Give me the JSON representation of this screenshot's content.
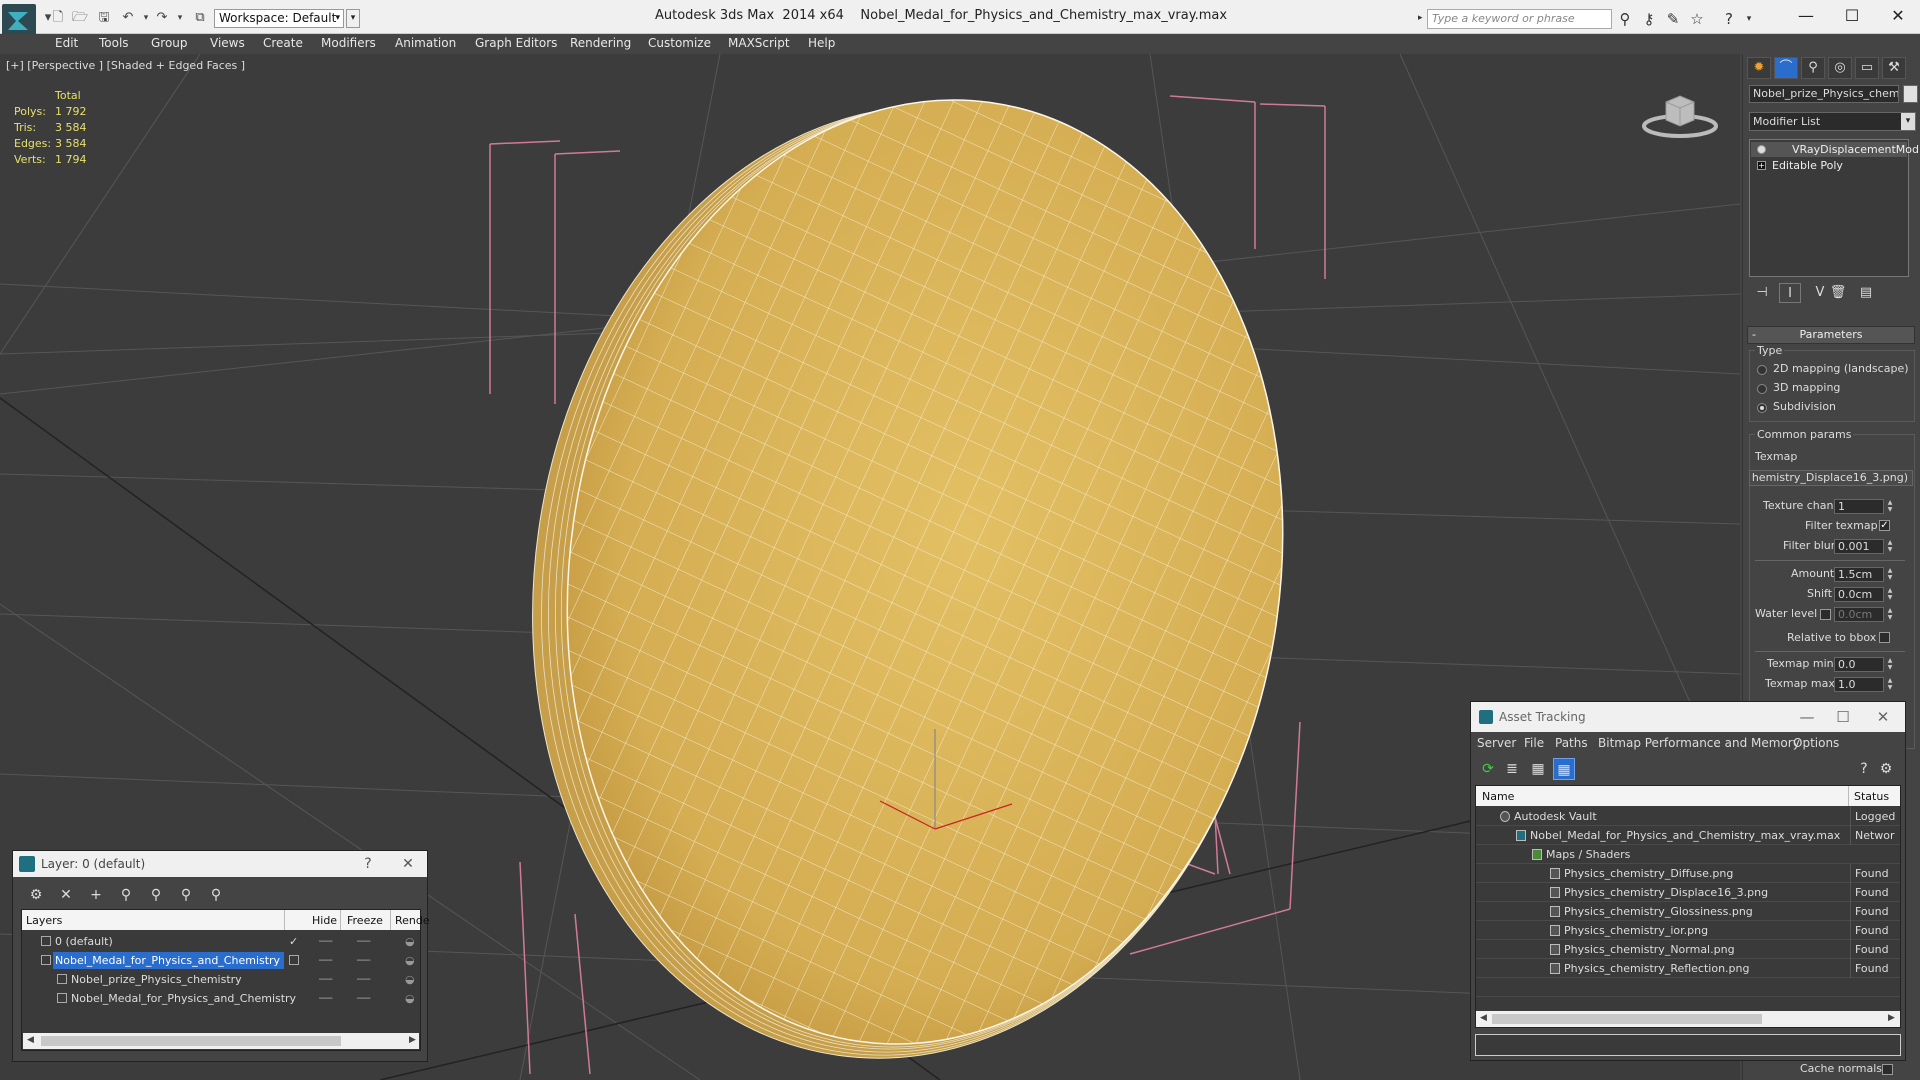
{
  "titlebar": {
    "workspace": "Workspace: Default",
    "app_name": "Autodesk 3ds Max  2014 x64",
    "file_name": "Nobel_Medal_for_Physics_and_Chemistry_max_vray.max",
    "search_placeholder": "Type a keyword or phrase"
  },
  "menu": [
    "Edit",
    "Tools",
    "Group",
    "Views",
    "Create",
    "Modifiers",
    "Animation",
    "Graph Editors",
    "Rendering",
    "Customize",
    "MAXScript",
    "Help"
  ],
  "viewport": {
    "label": "[+] [Perspective ] [Shaded + Edged Faces ]",
    "stats": {
      "header": "Total",
      "rows": [
        {
          "label": "Polys:",
          "value": "1 792"
        },
        {
          "label": "Tris:",
          "value": "3 584"
        },
        {
          "label": "Edges:",
          "value": "3 584"
        },
        {
          "label": "Verts:",
          "value": "1 794"
        }
      ]
    },
    "colors": {
      "background": "#3c3c3c",
      "grid": "#555555",
      "medal": "#d9b35a",
      "wire": "#f4eed8",
      "bbox": "#d07a9a"
    }
  },
  "command_panel": {
    "object_name": "Nobel_prize_Physics_chemistry",
    "modifier_list": "Modifier List",
    "stack": [
      "VRayDisplacementMod",
      "Editable Poly"
    ],
    "parameters_title": "Parameters",
    "type_label": "Type",
    "type_options": [
      "2D mapping (landscape)",
      "3D mapping",
      "Subdivision"
    ],
    "type_selected": "Subdivision",
    "common_params": "Common params",
    "texmap_label": "Texmap",
    "texmap_value": "hemistry_Displace16_3.png)",
    "texture_chan_label": "Texture chan",
    "texture_chan_value": "1",
    "filter_texmap_label": "Filter texmap",
    "filter_texmap_checked": true,
    "filter_blur_label": "Filter blur",
    "filter_blur_value": "0.001",
    "amount_label": "Amount",
    "amount_value": "1.5cm",
    "shift_label": "Shift",
    "shift_value": "0.0cm",
    "water_level_label": "Water level",
    "water_level_value": "0.0cm",
    "relative_bbox_label": "Relative to bbox",
    "texmap_min_label": "Texmap min",
    "texmap_min_value": "0.0",
    "texmap_max_label": "Texmap max",
    "texmap_max_value": "1.0",
    "cache_normals_label": "Cache normals"
  },
  "layer_window": {
    "title": "Layer: 0 (default)",
    "columns": [
      "Layers",
      "Hide",
      "Freeze",
      "Rende"
    ],
    "rows": [
      {
        "name": "0 (default)",
        "indent": 0
      },
      {
        "name": "Nobel_Medal_for_Physics_and_Chemistry",
        "indent": 0
      },
      {
        "name": "Nobel_prize_Physics_chemistry",
        "indent": 1
      },
      {
        "name": "Nobel_Medal_for_Physics_and_Chemistry",
        "indent": 1
      }
    ]
  },
  "asset_window": {
    "title": "Asset Tracking",
    "menu": [
      "Server",
      "File",
      "Paths",
      "Bitmap Performance and Memory",
      "Options"
    ],
    "columns": [
      "Name",
      "Status"
    ],
    "rows": [
      {
        "name": "Autodesk Vault",
        "status": "Logged",
        "indent": 1
      },
      {
        "name": "Nobel_Medal_for_Physics_and_Chemistry_max_vray.max",
        "status": "Networ",
        "indent": 2
      },
      {
        "name": "Maps / Shaders",
        "status": "",
        "indent": 3
      },
      {
        "name": "Physics_chemistry_Diffuse.png",
        "status": "Found",
        "indent": 4
      },
      {
        "name": "Physics_chemistry_Displace16_3.png",
        "status": "Found",
        "indent": 4
      },
      {
        "name": "Physics_chemistry_Glossiness.png",
        "status": "Found",
        "indent": 4
      },
      {
        "name": "Physics_chemistry_ior.png",
        "status": "Found",
        "indent": 4
      },
      {
        "name": "Physics_chemistry_Normal.png",
        "status": "Found",
        "indent": 4
      },
      {
        "name": "Physics_chemistry_Reflection.png",
        "status": "Found",
        "indent": 4
      }
    ]
  }
}
